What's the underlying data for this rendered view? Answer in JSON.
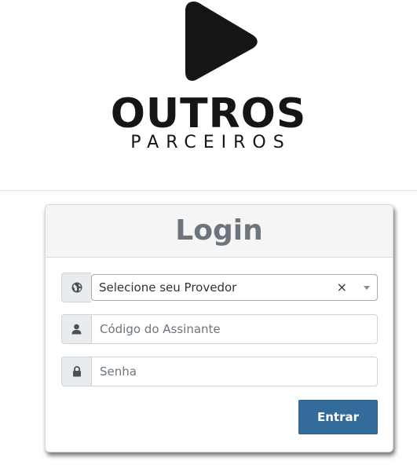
{
  "brand": {
    "title": "OUTROS",
    "subtitle": "PARCEIROS",
    "logo_icon": "play-icon",
    "color": "#151515"
  },
  "login": {
    "title": "Login",
    "provider_select": {
      "icon": "globe-icon",
      "selected_value": "Selecione seu Provedor",
      "clear_glyph": "×"
    },
    "subscriber_code": {
      "icon": "user-icon",
      "placeholder": "Código do Assinante",
      "value": ""
    },
    "password": {
      "icon": "lock-icon",
      "placeholder": "Senha",
      "value": ""
    },
    "submit_label": "Entrar"
  },
  "colors": {
    "button": "#336b9b",
    "title": "#6c757d",
    "header_bg": "#f5f5f5"
  }
}
